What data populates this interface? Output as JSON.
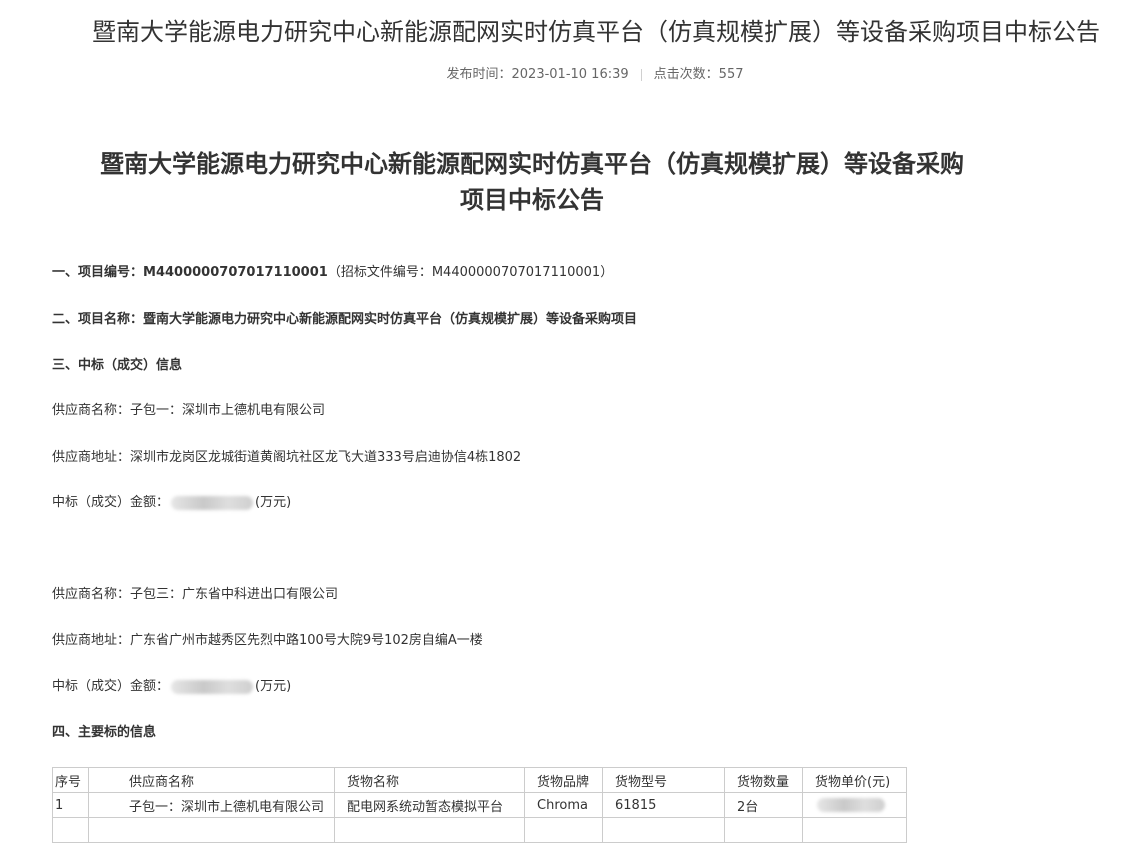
{
  "page": {
    "title": "暨南大学能源电力研究中心新能源配网实时仿真平台（仿真规模扩展）等设备采购项目中标公告",
    "publish_label": "发布时间：",
    "publish_time": "2023-01-10 16:39",
    "clicks_label": "点击次数：",
    "clicks": "557"
  },
  "document": {
    "title_line1": "暨南大学能源电力研究中心新能源配网实时仿真平台（仿真规模扩展）等设备采购",
    "title_line2": "项目中标公告",
    "s1_label": "一、项目编号：",
    "s1_value": "M4400000707017110001",
    "s1_note": "（招标文件编号：M4400000707017110001）",
    "s2_label": "二、项目名称：",
    "s2_value": "暨南大学能源电力研究中心新能源配网实时仿真平台（仿真规模扩展）等设备采购项目",
    "s3_label": "三、中标（成交）信息",
    "supplier1_name_label": "供应商名称：",
    "supplier1_name": "子包一：深圳市上德机电有限公司",
    "supplier1_addr_label": "供应商地址：",
    "supplier1_addr": "深圳市龙岗区龙城街道黄阁坑社区龙飞大道333号启迪协信4栋1802",
    "supplier1_amount_label": "中标（成交）金额：",
    "supplier1_amount_unit": "(万元)",
    "supplier2_name_label": "供应商名称：",
    "supplier2_name": "子包三：广东省中科进出口有限公司",
    "supplier2_addr_label": "供应商地址：",
    "supplier2_addr": "广东省广州市越秀区先烈中路100号大院9号102房自编A一楼",
    "supplier2_amount_label": "中标（成交）金额：",
    "supplier2_amount_unit": "(万元)",
    "s4_label": "四、主要标的信息"
  },
  "table": {
    "headers": [
      "序号",
      "供应商名称",
      "货物名称",
      "货物品牌",
      "货物型号",
      "货物数量",
      "货物单价(元)"
    ],
    "rows": [
      [
        "1",
        "子包一：深圳市上德机电有限公司",
        "配电网系统动暂态模拟平台",
        "Chroma",
        "61815",
        "2台",
        ""
      ],
      [
        "",
        "",
        "",
        "",
        "",
        "",
        ""
      ]
    ]
  }
}
